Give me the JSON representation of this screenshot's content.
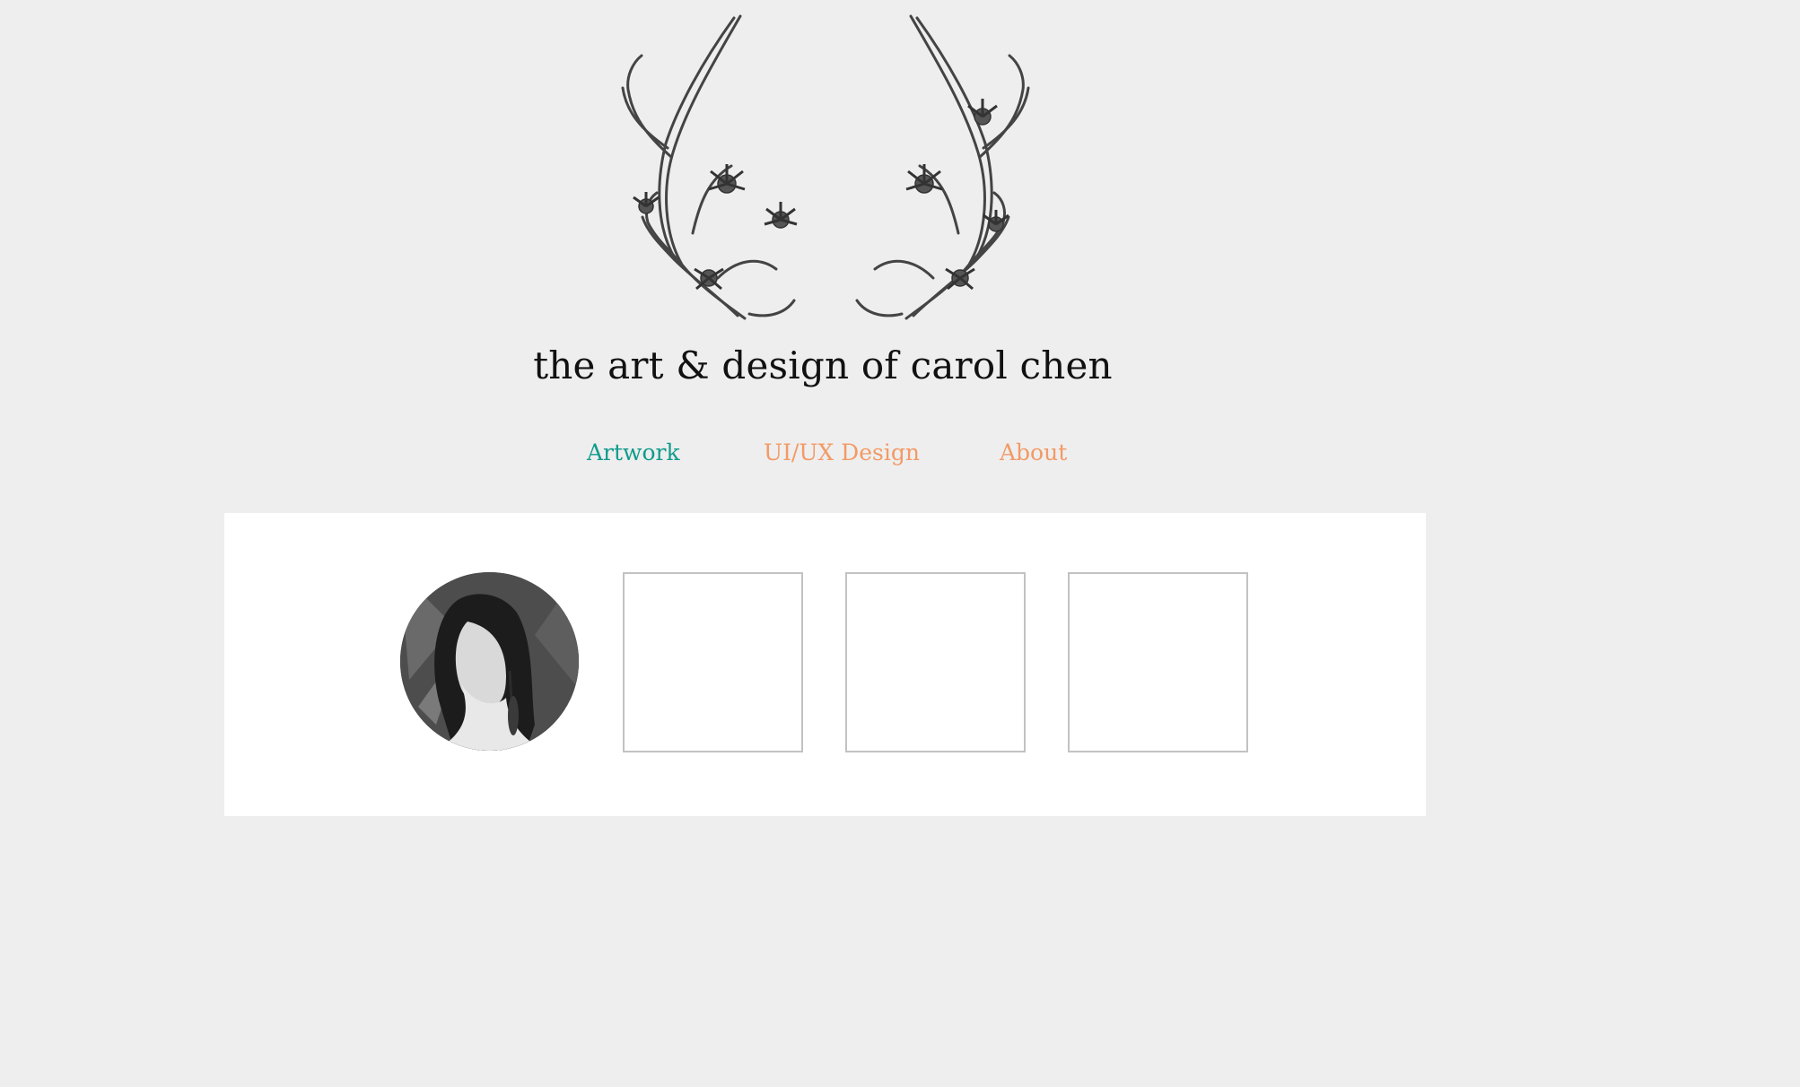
{
  "header": {
    "title": "the art & design of carol chen",
    "logo": "antlers-with-flowers-drawing"
  },
  "nav": {
    "items": [
      {
        "label": "Artwork",
        "color": "#119b8c"
      },
      {
        "label": "UI/UX Design",
        "color": "#f39a66"
      },
      {
        "label": "About",
        "color": "#f39a66"
      }
    ]
  },
  "gallery": {
    "avatar": "portrait-photo",
    "thumbnails": [
      "empty-thumbnail",
      "empty-thumbnail",
      "empty-thumbnail"
    ]
  },
  "colors": {
    "page_background": "#eeeeee",
    "panel_background": "#ffffff",
    "thumbnail_border": "#c2c2c2",
    "active_nav": "#119b8c",
    "inactive_nav": "#f39a66"
  }
}
